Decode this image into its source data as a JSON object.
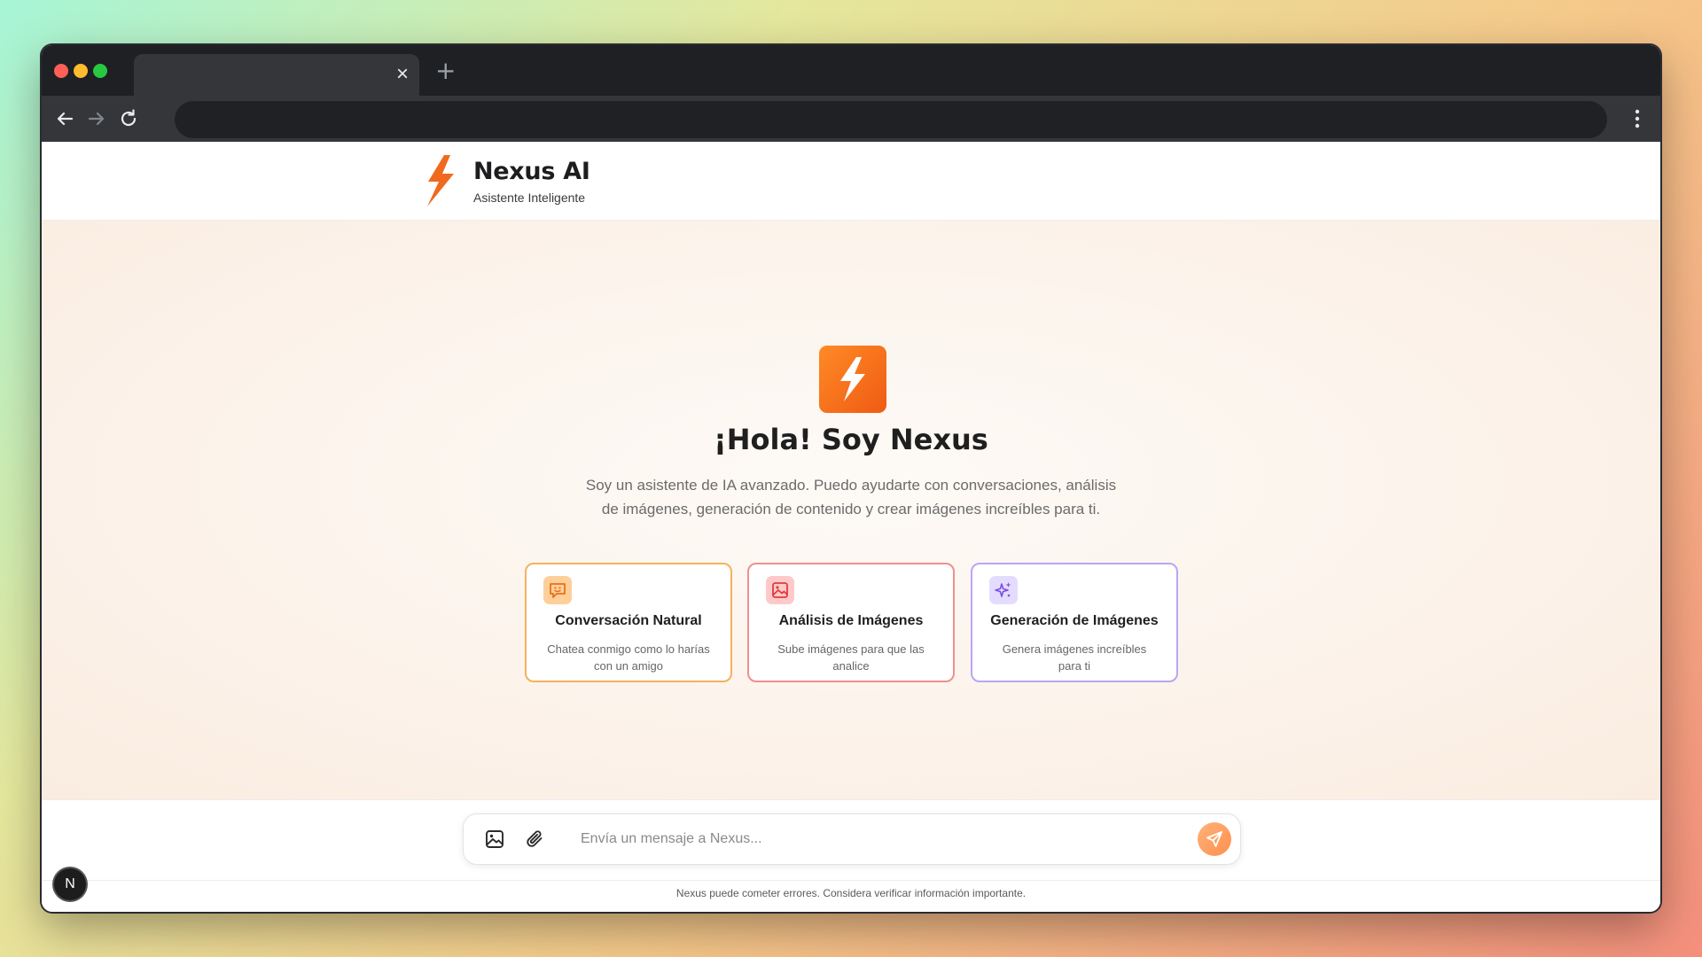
{
  "browser": {
    "tab_close": "×",
    "new_tab": "+"
  },
  "header": {
    "title": "Nexus AI",
    "subtitle": "Asistente Inteligente"
  },
  "hero": {
    "title": "¡Hola! Soy Nexus",
    "description": "Soy un asistente de IA avanzado. Puedo ayudarte con conversaciones, análisis de imágenes, generación de contenido y crear imágenes increíbles para ti."
  },
  "features": [
    {
      "title": "Conversación Natural",
      "description": "Chatea conmigo como lo harías con un amigo",
      "icon": "chat-smile-icon",
      "accent": "#f6b15c"
    },
    {
      "title": "Análisis de Imágenes",
      "description": "Sube imágenes para que las analice",
      "icon": "image-icon",
      "accent": "#f08f8f"
    },
    {
      "title": "Generación de Imágenes",
      "description": "Genera imágenes increíbles para ti",
      "icon": "sparkles-icon",
      "accent": "#b9a6f5"
    }
  ],
  "composer": {
    "placeholder": "Envía un mensaje a Nexus...",
    "image_button_icon": "image-upload-icon",
    "attach_button_icon": "paperclip-icon",
    "send_button_icon": "send-icon"
  },
  "footer": {
    "disclaimer": "Nexus puede cometer errores. Considera verificar información importante."
  },
  "badge": {
    "letter": "N"
  },
  "colors": {
    "brand": "#ef6a1f",
    "brand_gradient_start": "#ff8a26",
    "brand_gradient_end": "#ef5b13"
  }
}
